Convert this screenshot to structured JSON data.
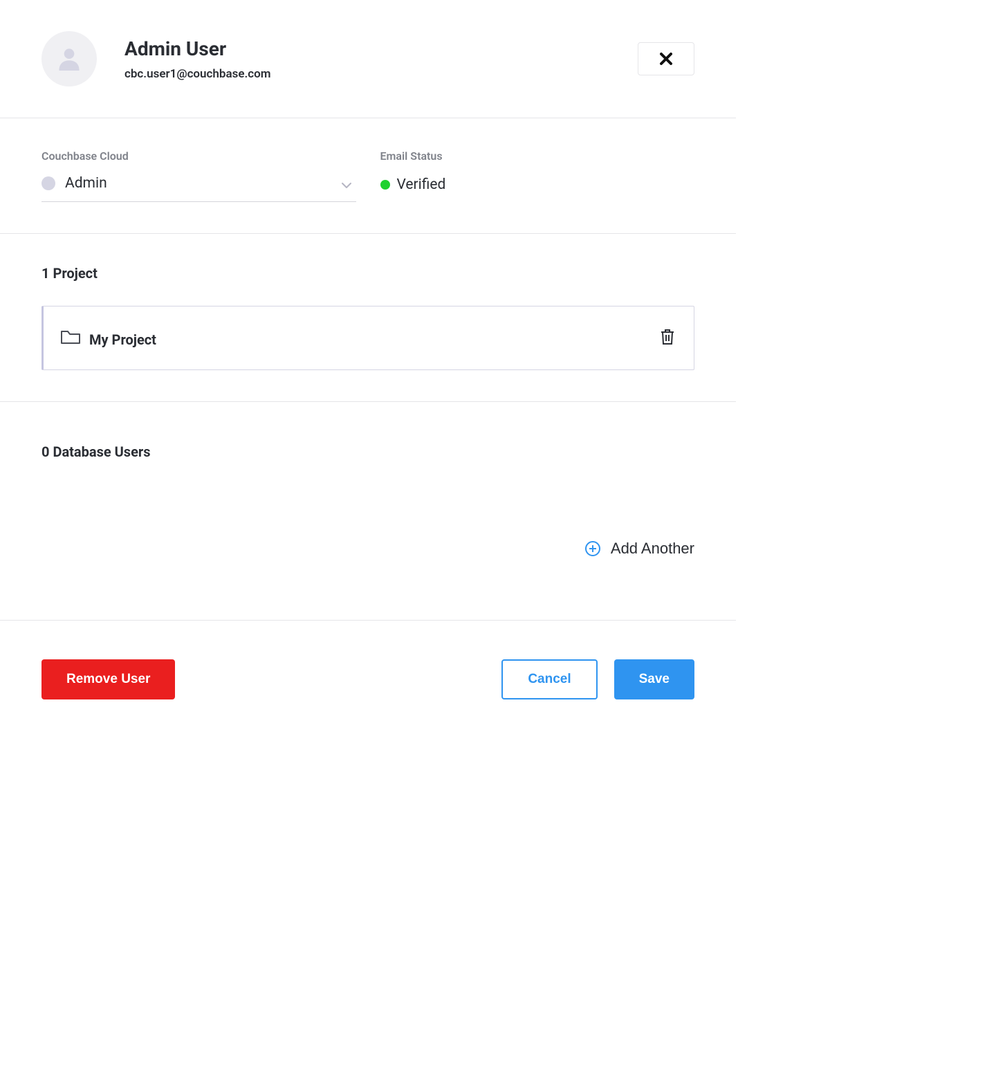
{
  "header": {
    "user_name": "Admin User",
    "user_email": "cbc.user1@couchbase.com"
  },
  "role_section": {
    "cloud_label": "Couchbase Cloud",
    "cloud_role": "Admin",
    "email_status_label": "Email Status",
    "email_status_value": "Verified"
  },
  "projects": {
    "heading": "1 Project",
    "items": [
      {
        "name": "My Project"
      }
    ]
  },
  "db_users": {
    "heading": "0 Database Users",
    "add_label": "Add Another"
  },
  "footer": {
    "remove": "Remove User",
    "cancel": "Cancel",
    "save": "Save"
  }
}
